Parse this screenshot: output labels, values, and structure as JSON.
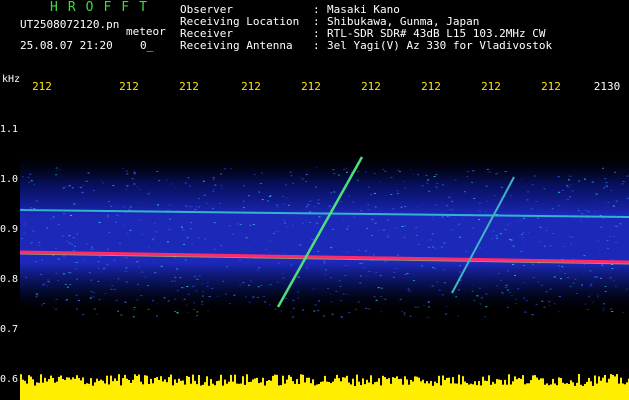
{
  "header": {
    "app_title": "HROFFT",
    "file_name": "UT2508072120.pn",
    "mode": "meteor",
    "date_time": "25.08.07 21:20",
    "extra": "0_"
  },
  "info": [
    {
      "key": "Observer",
      "sep": ":",
      "value": "Masaki Kano"
    },
    {
      "key": "Receiving Location",
      "sep": ":",
      "value": "Shibukawa, Gunma, Japan"
    },
    {
      "key": "Receiver",
      "sep": ":",
      "value": "RTL-SDR SDR# 43dB L15 103.2MHz CW"
    },
    {
      "key": "Receiving Antenna",
      "sep": ":",
      "value": "3el Yagi(V) Az 330 for Vladivostok"
    }
  ],
  "axis": {
    "y_unit": "kHz",
    "x_ticks": [
      "212",
      "212",
      "212",
      "212",
      "212",
      "212",
      "212",
      "212",
      "212",
      "2130"
    ],
    "y_ticks": [
      "1.1",
      "1.0",
      "0.9",
      "0.8",
      "0.7",
      "0.6"
    ]
  },
  "colors": {
    "background": "#000000",
    "title": "#3cdc3c",
    "tick": "#ffe400",
    "noise": "#1e2ccc",
    "signal": "#ff2a6a",
    "trace": "#4fdf7a",
    "level": "#ffee00"
  }
}
